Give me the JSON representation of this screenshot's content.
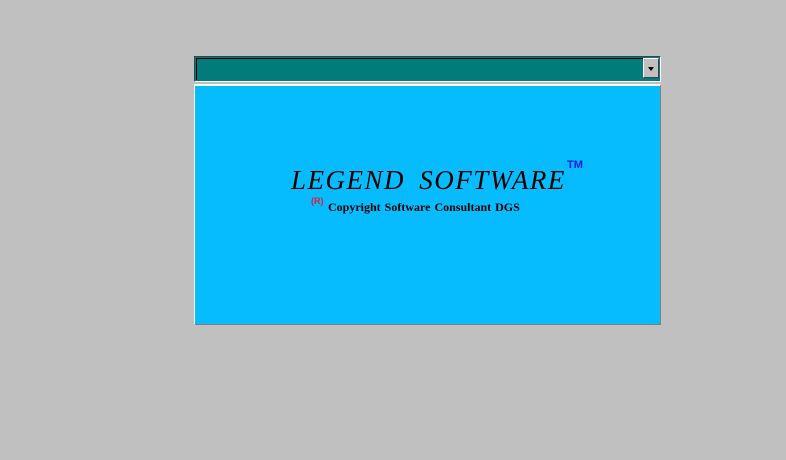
{
  "colors": {
    "desktop": "#c0c0c0",
    "combo_background": "#007c7c",
    "panel_background": "#06bcff",
    "trademark": "#1a1ad6",
    "registered": "#d8203c"
  },
  "combo": {
    "value": "",
    "dropdown_icon": "chevron-down-icon"
  },
  "splash": {
    "title": "LEGEND  SOFTWARE",
    "trademark": "TM",
    "registered": "(R)",
    "copyright": "Copyright  Software Consultant DGS"
  }
}
